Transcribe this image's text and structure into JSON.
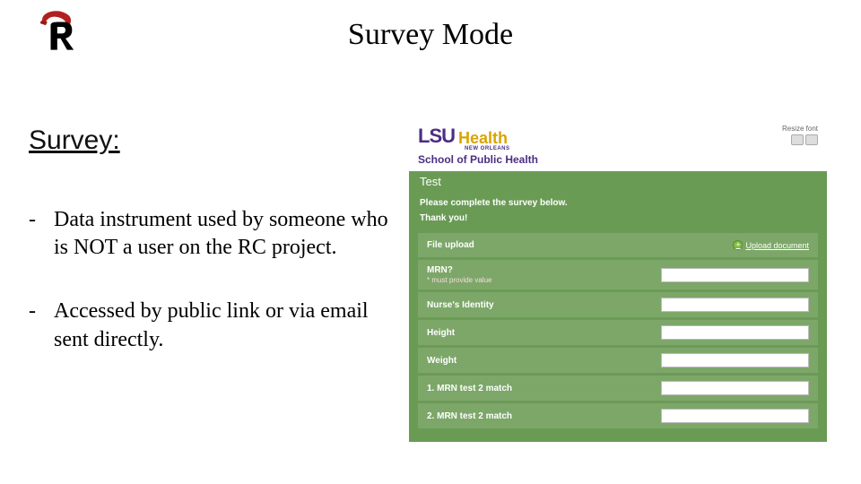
{
  "title": "Survey Mode",
  "subtitle": "Survey:",
  "bullets": [
    "Data instrument used by someone who is NOT a user on the RC project.",
    "Accessed by public link  or via email sent directly."
  ],
  "logo": {
    "name": "redcap-logo"
  },
  "survey": {
    "brand": {
      "lsu": "LSU",
      "health": "Health",
      "new_orleans": "NEW ORLEANS",
      "school": "School of Public Health"
    },
    "resize_label": "Resize font",
    "test_label": "Test",
    "prompt": "Please complete the survey below.",
    "thanks": "Thank you!",
    "upload": {
      "label": "File upload",
      "link": "Upload document"
    },
    "fields": [
      {
        "label": "MRN?",
        "required": "* must provide value"
      },
      {
        "label": "Nurse's Identity"
      },
      {
        "label": "Height"
      },
      {
        "label": "Weight"
      },
      {
        "label": "1. MRN test 2 match"
      },
      {
        "label": "2. MRN test 2 match"
      }
    ]
  }
}
